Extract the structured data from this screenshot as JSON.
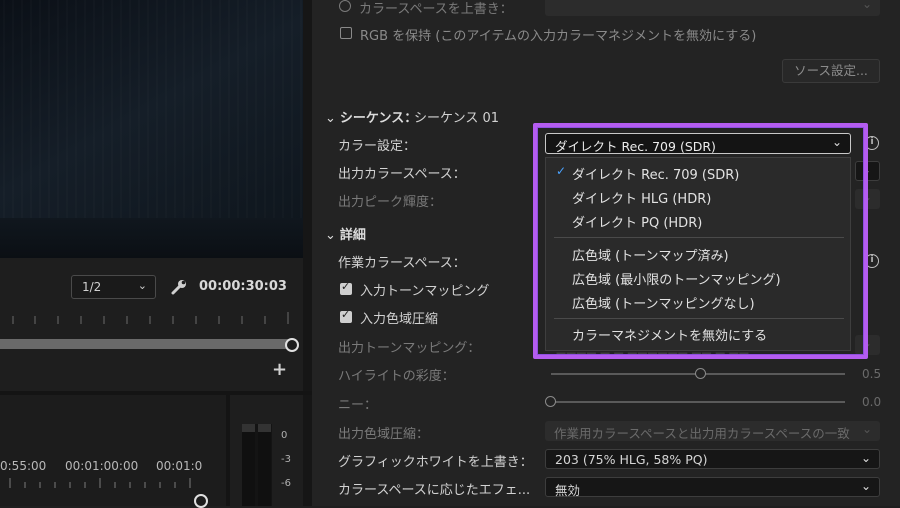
{
  "viewer": {
    "zoom_value": "1/2",
    "timecode": "00:00:30:03",
    "add_label": "+"
  },
  "timeline": {
    "labels": [
      "0:55:00",
      "00:01:00:00",
      "00:01:0"
    ],
    "meter_db": [
      "0",
      "-3",
      "-6"
    ]
  },
  "source": {
    "override_label": "カラースペースを上書き：",
    "preserve_rgb_label": "RGB を保持 (このアイテムの入力カラーマネジメントを無効にする)",
    "source_settings_button": "ソース設定..."
  },
  "sequence": {
    "section_label": "シーケンス：",
    "sequence_name": "シーケンス 01",
    "color_setting_label": "カラー設定：",
    "color_setting_value": "ダイレクト Rec. 709 (SDR)",
    "output_color_space_label": "出力カラースペース：",
    "output_peak_label": "出力ピーク輝度："
  },
  "color_setting_menu": {
    "items": [
      {
        "label": "ダイレクト Rec. 709 (SDR)",
        "selected": true
      },
      {
        "label": "ダイレクト HLG (HDR)",
        "selected": false
      },
      {
        "label": "ダイレクト PQ (HDR)",
        "selected": false
      },
      {
        "label": "広色域 (トーンマップ済み)",
        "selected": false
      },
      {
        "label": "広色域 (最小限のトーンマッピング)",
        "selected": false
      },
      {
        "label": "広色域 (トーンマッピングなし)",
        "selected": false
      },
      {
        "label": "カラーマネジメントを無効にする",
        "selected": false
      }
    ]
  },
  "details": {
    "section_label": "詳細",
    "working_color_space_label": "作業カラースペース：",
    "input_tone_mapping_label": "入力トーンマッピング",
    "input_gamut_compression_label": "入力色域圧縮",
    "output_tone_mapping_label": "出力トーンマッピング：",
    "highlight_saturation_label": "ハイライトの彩度：",
    "highlight_saturation_value": "0.5",
    "knee_label": "ニー：",
    "knee_value": "0.0",
    "output_gamut_compression_label": "出力色域圧縮：",
    "output_gamut_compression_value": "作業用カラースペースと出力用カラースペースの一致",
    "graphics_white_label": "グラフィックホワイトを上書き：",
    "graphics_white_value": "203 (75% HLG, 58% PQ)",
    "color_space_effects_label": "カラースペースに応じたエフェ...",
    "color_space_effects_value": "無効"
  },
  "colors": {
    "highlight_border": "#b45cf0",
    "check_accent": "#4aa3ff"
  }
}
